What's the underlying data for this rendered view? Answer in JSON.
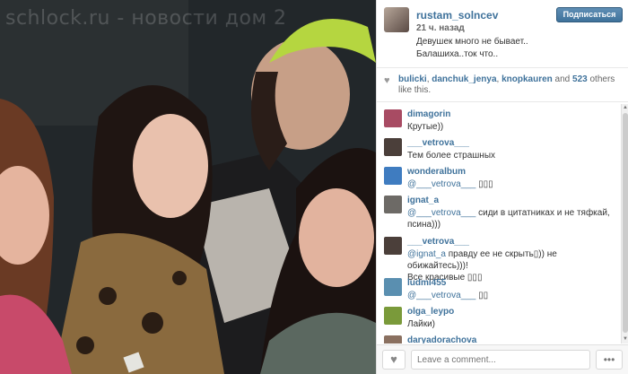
{
  "watermark": "schlock.ru - новости дом 2",
  "post": {
    "username": "rustam_solncev",
    "time": "21 ч. назад",
    "caption_line1": "Девушек много не бывает..",
    "caption_line2": "Балашиха..ток что..",
    "follow_label": "Подписаться"
  },
  "likes": {
    "users": [
      "bulicki",
      "danchuk_jenya",
      "knopkauren"
    ],
    "sep1": ", ",
    "sep2": ", ",
    "and": " and ",
    "count": "523",
    "suffix": " others like this."
  },
  "comments": [
    {
      "user": "dimagorin",
      "text": "Крутые))",
      "mention": "",
      "avatar_color": "#a84b63"
    },
    {
      "user": "___vetrova___",
      "text": "Тем более страшных",
      "mention": "",
      "avatar_color": "#4b3f3a"
    },
    {
      "user": "wonderalbum",
      "text": " ▯▯▯",
      "mention": "@___vetrova___",
      "avatar_color": "#3f7cc0"
    },
    {
      "user": "ignat_a",
      "text": " сиди в цитатниках и не тяфкай,",
      "text2": "псина)))",
      "mention": "@___vetrova___",
      "avatar_color": "#6d6a66"
    },
    {
      "user": "___vetrova___",
      "text": " правду ее не скрыть▯)) не обижайтесь)))!",
      "text2": "Все красивые ▯▯▯",
      "mention": "@ignat_a",
      "avatar_color": "#4b3f3a"
    },
    {
      "user": "ludmi455",
      "text": " ▯▯",
      "mention": "@___vetrova___",
      "avatar_color": "#5a8fb0"
    },
    {
      "user": "olga_leypo",
      "text": "Лайки)",
      "mention": "",
      "avatar_color": "#7a9a3a"
    },
    {
      "user": "daryadorachova",
      "text": "",
      "mention": "",
      "avatar_color": "#8a7060"
    }
  ],
  "footer": {
    "like_icon": "♥",
    "comment_placeholder": "Leave a comment...",
    "more_label": "•••"
  },
  "scrollbar": {
    "up": "▲",
    "down": "▼"
  }
}
